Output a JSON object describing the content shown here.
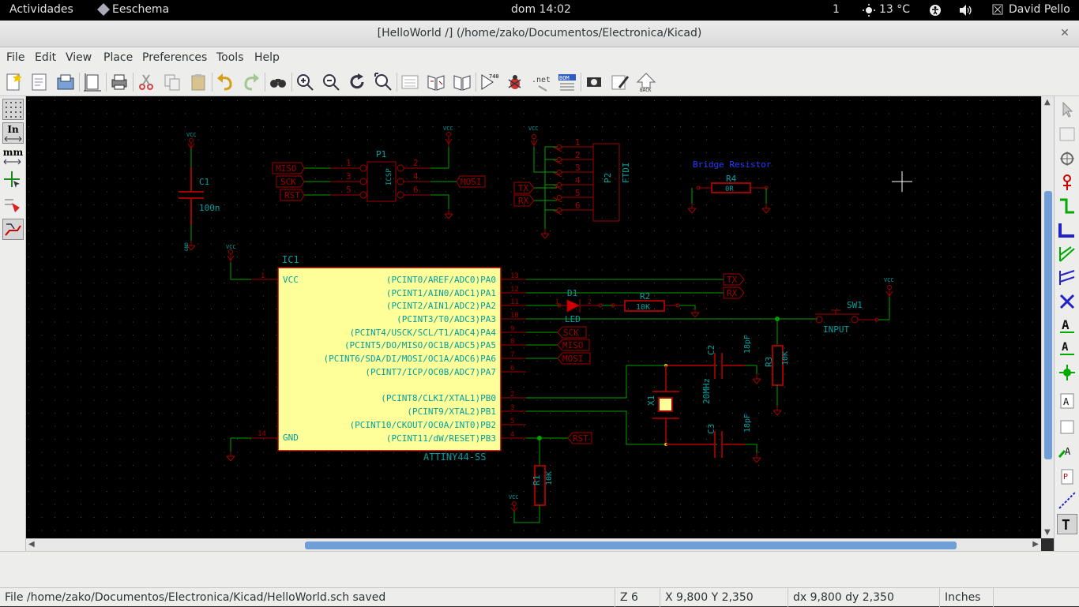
{
  "topbar": {
    "activities": "Actividades",
    "app_name": "Eeschema",
    "clock": "dom 14:02",
    "workspace": "1",
    "weather": "13 °C",
    "user": "David Pello"
  },
  "window": {
    "title": "[HelloWorld /] (/home/zako/Documentos/Electronica/Kicad)"
  },
  "menu": {
    "items": [
      "File",
      "Edit",
      "View",
      "Place",
      "Preferences",
      "Tools",
      "Help"
    ]
  },
  "left_toolbar": {
    "units_in": "In",
    "units_mm": "mm"
  },
  "schematic": {
    "ic1": {
      "ref": "IC1",
      "value": "ATTINY44-SS",
      "vcc_label": "VCC",
      "gnd_label": "GND",
      "vcc_pin": "1",
      "gnd_pin": "14",
      "pins": [
        {
          "name": "(PCINT0/AREF/ADC0)PA0",
          "num": "13"
        },
        {
          "name": "(PCINT1/AIN0/ADC1)PA1",
          "num": "12"
        },
        {
          "name": "(PCINT2/AIN1/ADC2)PA2",
          "num": "11"
        },
        {
          "name": "(PCINT3/T0/ADC3)PA3",
          "num": "10"
        },
        {
          "name": "(PCINT4/USCK/SCL/T1/ADC4)PA4",
          "num": "9"
        },
        {
          "name": "(PCINT5/DO/MISO/OC1B/ADC5)PA5",
          "num": "8"
        },
        {
          "name": "(PCINT6/SDA/DI/MOSI/OC1A/ADC6)PA6",
          "num": "7"
        },
        {
          "name": "(PCINT7/ICP/OC0B/ADC7)PA7",
          "num": "6"
        },
        {
          "name": "(PCINT8/CLKI/XTAL1)PB0",
          "num": "2"
        },
        {
          "name": "(PCINT9/XTAL2)PB1",
          "num": "3"
        },
        {
          "name": "(PCINT10/CKOUT/OC0A/INT0)PB2",
          "num": "5"
        },
        {
          "name": "(PCINT11/dW/RESET)PB3",
          "num": "4"
        }
      ]
    },
    "c1": {
      "ref": "C1",
      "value": "100n"
    },
    "p1": {
      "ref": "P1",
      "body": "ICSP",
      "labels": [
        "MISO",
        "SCK",
        "RST"
      ],
      "out": "MOSI",
      "pins": [
        "1",
        "2",
        "3",
        "4",
        "5",
        "6"
      ]
    },
    "p2": {
      "ref": "P2",
      "value": "FTDI",
      "pins": [
        "1",
        "2",
        "3",
        "4",
        "5",
        "6"
      ],
      "tx": "TX",
      "rx": "RX"
    },
    "r4": {
      "title": "Bridge Resistor",
      "ref": "R4",
      "value": "0R"
    },
    "d1": {
      "ref": "D1",
      "value": "LED",
      "pin1": "1",
      "pin2": "2"
    },
    "r2": {
      "ref": "R2",
      "value": "10K"
    },
    "sw1": {
      "ref": "SW1",
      "value": "INPUT"
    },
    "c2": {
      "ref": "C2",
      "value": "18pF"
    },
    "c3": {
      "ref": "C3",
      "value": "18pF"
    },
    "x1": {
      "ref": "X1",
      "value": "20MHz"
    },
    "r3": {
      "ref": "R3",
      "value": "10K"
    },
    "r1": {
      "ref": "R1",
      "value": "10K"
    },
    "net_labels": {
      "tx": "TX",
      "rx": "RX",
      "sck": "SCK",
      "miso": "MISO",
      "mosi": "MOSI",
      "rst": "RST"
    },
    "vcc": "VCC",
    "gnd": "GND"
  },
  "status": {
    "message": "File /home/zako/Documentos/Electronica/Kicad/HelloWorld.sch saved",
    "zoom": "Z 6",
    "coords": "X 9,800  Y 2,350",
    "delta": "dx 9,800  dy 2,350",
    "units": "Inches"
  },
  "colors": {
    "background": "#000000",
    "wire": "#00a000",
    "component": "#a00000",
    "ic_fill": "#ffff99",
    "text_cyan": "#00a0a0"
  }
}
